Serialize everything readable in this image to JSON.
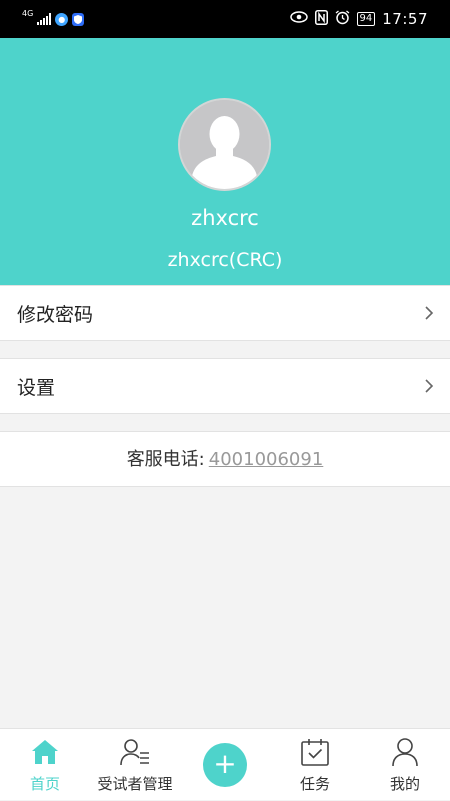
{
  "status_bar": {
    "network": "4G",
    "battery": "94",
    "time": "17:57",
    "icons": [
      "signal-icon",
      "message-badge-icon",
      "shield-app-icon",
      "eye-icon",
      "nfc-icon",
      "alarm-icon",
      "battery-icon"
    ]
  },
  "profile": {
    "name": "zhxcrc",
    "role": "zhxcrc(CRC)",
    "avatar_icon": "default-user-avatar-icon"
  },
  "menu": {
    "change_password": "修改密码",
    "settings": "设置"
  },
  "hotline": {
    "label": "客服电话:",
    "number": "4001006091"
  },
  "tabbar": {
    "home": "首页",
    "subjects": "受试者管理",
    "add": "+",
    "tasks": "任务",
    "mine": "我的"
  },
  "colors": {
    "accent": "#4ed3cb",
    "background": "#f3f3f3",
    "avatar": "#c6c6c8"
  }
}
